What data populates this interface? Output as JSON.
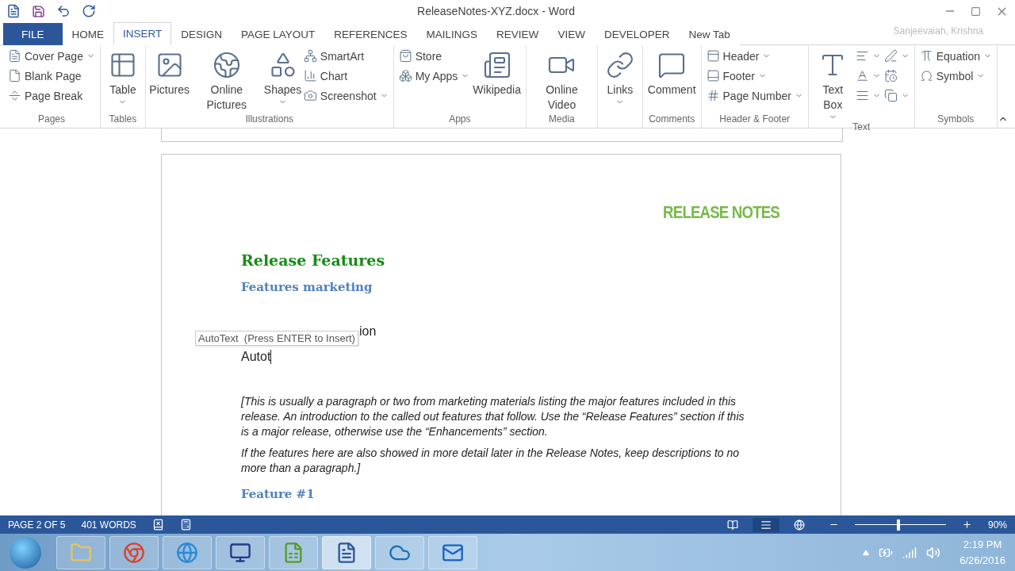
{
  "window": {
    "title": "ReleaseNotes-XYZ.docx - Word",
    "user": "Sanjeevaiah, Krishna"
  },
  "tabs": [
    {
      "label": "FILE",
      "kind": "file",
      "selected": false
    },
    {
      "label": "HOME",
      "kind": "tab",
      "selected": false
    },
    {
      "label": "INSERT",
      "kind": "tab",
      "selected": true
    },
    {
      "label": "DESIGN",
      "kind": "tab",
      "selected": false
    },
    {
      "label": "PAGE LAYOUT",
      "kind": "tab",
      "selected": false
    },
    {
      "label": "REFERENCES",
      "kind": "tab",
      "selected": false
    },
    {
      "label": "MAILINGS",
      "kind": "tab",
      "selected": false
    },
    {
      "label": "REVIEW",
      "kind": "tab",
      "selected": false
    },
    {
      "label": "VIEW",
      "kind": "tab",
      "selected": false
    },
    {
      "label": "DEVELOPER",
      "kind": "tab",
      "selected": false
    },
    {
      "label": "New Tab",
      "kind": "tab",
      "selected": false
    }
  ],
  "ribbon": [
    {
      "name": "Pages",
      "columns": [
        {
          "kind": "stack",
          "items": [
            {
              "label": "Cover Page",
              "dropdown": true
            },
            {
              "label": "Blank Page",
              "dropdown": false
            },
            {
              "label": "Page Break",
              "dropdown": false
            }
          ]
        }
      ]
    },
    {
      "name": "Tables",
      "columns": [
        {
          "kind": "large",
          "label": "Table",
          "dropdown": true
        }
      ]
    },
    {
      "name": "Illustrations",
      "columns": [
        {
          "kind": "large",
          "label": "Pictures",
          "dropdown": false
        },
        {
          "kind": "large",
          "label": "Online Pictures",
          "dropdown": false
        },
        {
          "kind": "large",
          "label": "Shapes",
          "dropdown": true
        },
        {
          "kind": "stack",
          "items": [
            {
              "label": "SmartArt",
              "dropdown": false
            },
            {
              "label": "Chart",
              "dropdown": false
            },
            {
              "label": "Screenshot",
              "dropdown": true
            }
          ]
        }
      ]
    },
    {
      "name": "Apps",
      "columns": [
        {
          "kind": "stack",
          "items": [
            {
              "label": "Store",
              "dropdown": false
            },
            {
              "label": "My Apps",
              "dropdown": true
            }
          ]
        },
        {
          "kind": "large",
          "label": "Wikipedia",
          "dropdown": false
        }
      ]
    },
    {
      "name": "Media",
      "columns": [
        {
          "kind": "large",
          "label": "Online Video",
          "dropdown": false
        }
      ]
    },
    {
      "columns": [
        {
          "kind": "large",
          "label": "Links",
          "dropdown": true
        }
      ]
    },
    {
      "name": "Comments",
      "columns": [
        {
          "kind": "large",
          "label": "Comment",
          "dropdown": false
        }
      ]
    },
    {
      "name": "Header & Footer",
      "columns": [
        {
          "kind": "stack",
          "items": [
            {
              "label": "Header",
              "dropdown": true
            },
            {
              "label": "Footer",
              "dropdown": true
            },
            {
              "label": "Page Number",
              "dropdown": true
            }
          ]
        }
      ]
    },
    {
      "name": "Text",
      "columns": [
        {
          "kind": "large",
          "label": "Text Box",
          "dropdown": true
        },
        {
          "kind": "stack",
          "items": [
            {
              "dropdown": true
            },
            {
              "dropdown": true
            },
            {
              "dropdown": true
            }
          ]
        },
        {
          "kind": "stack",
          "items": [
            {
              "dropdown": true
            },
            {
              "dropdown": false
            },
            {
              "dropdown": true
            }
          ]
        }
      ]
    },
    {
      "name": "Symbols",
      "columns": [
        {
          "kind": "stack",
          "items": [
            {
              "label": "Equation",
              "dropdown": true
            },
            {
              "label": "Symbol",
              "dropdown": true
            }
          ]
        }
      ]
    }
  ],
  "document": {
    "banner": "RELEASE NOTES",
    "heading1": "Release Features",
    "heading2": "Features marketing",
    "typed_line_visible": "ion",
    "tooltip": "AutoText  (Press ENTER to Insert)",
    "typing": "Autot",
    "paragraphs": [
      "[This is usually a paragraph or two from marketing materials listing the major features included in this release. An introduction to the called out features that follow. Use the “Release Features” section if this is a major release, otherwise use the “Enhancements” section.",
      "If the features here are also showed in more detail later in the Release Notes, keep descriptions to no more than a paragraph.]"
    ],
    "heading3": "Feature #1"
  },
  "status_bar": {
    "page": "PAGE 2 OF 5",
    "words": "401 WORDS",
    "views": [
      {
        "selected": false
      },
      {
        "selected": true
      },
      {
        "selected": false
      }
    ],
    "zoom": {
      "level": 0.48,
      "reading": "90%"
    }
  },
  "taskbar": {
    "apps": [
      {
        "active": false
      },
      {
        "active": false
      },
      {
        "active": false
      },
      {
        "active": false
      },
      {
        "active": false
      },
      {
        "active": true
      },
      {
        "active": false
      },
      {
        "active": false
      }
    ],
    "time": "2:19 PM",
    "date": "6/26/2016"
  }
}
